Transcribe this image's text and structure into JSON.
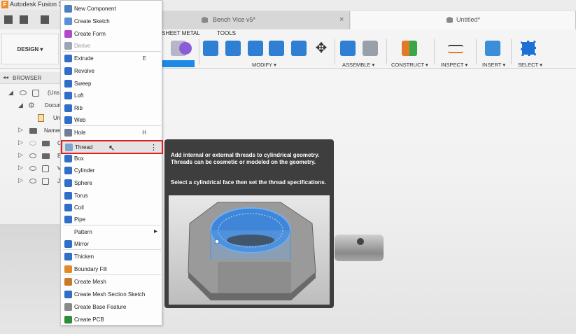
{
  "app": {
    "title": "Autodesk Fusion 3("
  },
  "tabs": [
    {
      "label": "Bench Vice v5*",
      "active": false
    },
    {
      "label": "Untitled*",
      "active": true
    }
  ],
  "toolbar": {
    "design_label": "DESIGN ▾",
    "tab_sheet_metal": "SHEET METAL",
    "tab_tools": "TOOLS",
    "groups": {
      "modify": "MODIFY ▾",
      "assemble": "ASSEMBLE ▾",
      "construct": "CONSTRUCT ▾",
      "inspect": "INSPECT ▾",
      "insert": "INSERT ▾",
      "select": "SELECT ▾"
    }
  },
  "browser": {
    "title": "BROWSER",
    "rows": [
      {
        "label": "(Uns"
      },
      {
        "label": "Docum"
      },
      {
        "label": "Un"
      },
      {
        "label": "Named"
      },
      {
        "label": "O"
      },
      {
        "label": "B"
      },
      {
        "label": "V"
      },
      {
        "label": "J"
      }
    ]
  },
  "menu": {
    "items": [
      {
        "label": "New Component",
        "shortcut": "",
        "color": "#4a7fc1"
      },
      {
        "label": "Create Sketch",
        "shortcut": "",
        "color": "#5b8fd6"
      },
      {
        "label": "Create Form",
        "shortcut": "",
        "color": "#b04ac9"
      },
      {
        "label": "Derive",
        "shortcut": "",
        "color": "#9aa6b5",
        "disabled": true
      },
      {
        "label": "Extrude",
        "shortcut": "E",
        "color": "#2f6fc8"
      },
      {
        "label": "Revolve",
        "shortcut": "",
        "color": "#2f6fc8"
      },
      {
        "label": "Sweep",
        "shortcut": "",
        "color": "#2f6fc8"
      },
      {
        "label": "Loft",
        "shortcut": "",
        "color": "#2f6fc8"
      },
      {
        "label": "Rib",
        "shortcut": "",
        "color": "#2f6fc8"
      },
      {
        "label": "Web",
        "shortcut": "",
        "color": "#2f6fc8"
      },
      {
        "label": "Hole",
        "shortcut": "H",
        "color": "#6d7f96"
      },
      {
        "label": "Thread",
        "shortcut": "",
        "color": "#7fa2cf"
      },
      {
        "label": "Box",
        "shortcut": "",
        "color": "#2f6fc8"
      },
      {
        "label": "Cylinder",
        "shortcut": "",
        "color": "#2f6fc8"
      },
      {
        "label": "Sphere",
        "shortcut": "",
        "color": "#2f6fc8"
      },
      {
        "label": "Torus",
        "shortcut": "",
        "color": "#2f6fc8"
      },
      {
        "label": "Coil",
        "shortcut": "",
        "color": "#2f6fc8"
      },
      {
        "label": "Pipe",
        "shortcut": "",
        "color": "#2f6fc8"
      },
      {
        "label": "Pattern",
        "shortcut": "",
        "color": ""
      },
      {
        "label": "Mirror",
        "shortcut": "",
        "color": "#2f6fc8"
      },
      {
        "label": "Thicken",
        "shortcut": "",
        "color": "#2f6fc8"
      },
      {
        "label": "Boundary Fill",
        "shortcut": "",
        "color": "#e08a2a"
      },
      {
        "label": "Create Mesh",
        "shortcut": "",
        "color": "#c77a2a"
      },
      {
        "label": "Create Mesh Section Sketch",
        "shortcut": "",
        "color": "#2f6fc8"
      },
      {
        "label": "Create Base Feature",
        "shortcut": "",
        "color": "#8a8a8a"
      },
      {
        "label": "Create PCB",
        "shortcut": "",
        "color": "#2e8b3a"
      }
    ]
  },
  "tooltip": {
    "line1": "Add internal or external threads to cylindrical geometry. Threads can be cosmetic or modeled on the geometry.",
    "line2": "Select a cylindrical face then set the thread specifications."
  },
  "colors": {
    "accent": "#1e88e5",
    "highlight_border": "#e02020",
    "tooltip_bg": "#3e3e3e"
  }
}
